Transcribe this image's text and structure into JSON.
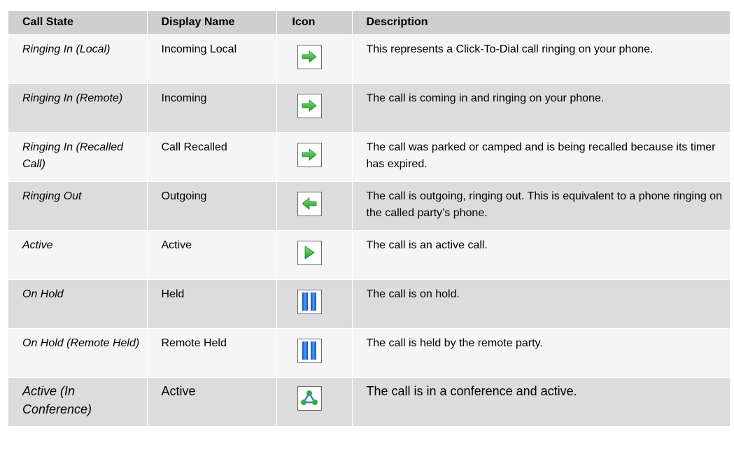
{
  "table": {
    "headers": {
      "call_state": "Call State",
      "display_name": "Display Name",
      "icon": "Icon",
      "description": "Description"
    },
    "rows": [
      {
        "call_state": "Ringing In (Local)",
        "display_name": "Incoming Local",
        "icon": "arrow-right-icon",
        "description": "This represents a Click-To-Dial call ringing on your phone."
      },
      {
        "call_state": "Ringing In (Remote)",
        "display_name": "Incoming",
        "icon": "arrow-right-icon",
        "description": "The call is coming in and ringing on your phone."
      },
      {
        "call_state": "Ringing In (Recalled Call)",
        "display_name": "Call Recalled",
        "icon": "arrow-right-icon",
        "description": "The call was parked or camped and is being recalled because its timer has expired."
      },
      {
        "call_state": "Ringing Out",
        "display_name": "Outgoing",
        "icon": "arrow-left-icon",
        "description": "The call is outgoing, ringing out.  This is equivalent to a phone ringing on the called party’s phone."
      },
      {
        "call_state": "Active",
        "display_name": "Active",
        "icon": "play-icon",
        "description": "The call is an active call."
      },
      {
        "call_state": "On Hold",
        "display_name": "Held",
        "icon": "pause-icon",
        "description": "The call is on hold."
      },
      {
        "call_state": "On Hold (Remote Held)",
        "display_name": "Remote Held",
        "icon": "pause-icon",
        "description": "The call is held by the remote party."
      },
      {
        "call_state": "Active (In Conference)",
        "display_name": "Active",
        "icon": "conference-icon",
        "description": "The call is in a conference and active."
      }
    ]
  },
  "colors": {
    "header_bg": "#cfcfcf",
    "row_light": "#f5f5f5",
    "row_dark": "#dcdcdc",
    "arrow_green": "#3cb83c",
    "pause_blue": "#1f6fd6",
    "conference_blue": "#2f7fd0",
    "conference_green": "#3aa84a"
  }
}
